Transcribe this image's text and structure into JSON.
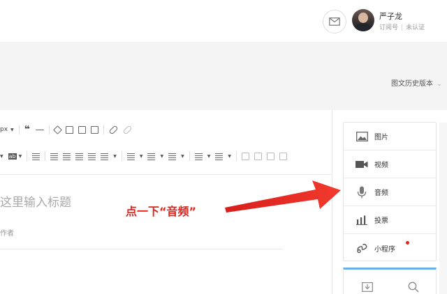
{
  "header": {
    "user_name": "严子龙",
    "account_type": "订阅号",
    "verify_status": "未认证"
  },
  "editor_header": {
    "history_label": "图文历史版本"
  },
  "toolbar": {
    "font_size_fragment": "px",
    "background_color_label": "ab"
  },
  "editor": {
    "title_placeholder": "这里输入标题",
    "author_placeholder": "作者"
  },
  "annotation": {
    "text": "点一下“音频”",
    "color": "#e0231c"
  },
  "insert_panel": {
    "items": [
      {
        "label": "图片",
        "icon": "image-icon"
      },
      {
        "label": "视频",
        "icon": "video-icon"
      },
      {
        "label": "音频",
        "icon": "microphone-icon"
      },
      {
        "label": "投票",
        "icon": "poll-icon"
      },
      {
        "label": "小程序",
        "icon": "miniprogram-icon",
        "has_dot": true
      }
    ]
  },
  "colors": {
    "accent_blue": "#6ab0e6",
    "gray_band": "#f4f4f5"
  }
}
